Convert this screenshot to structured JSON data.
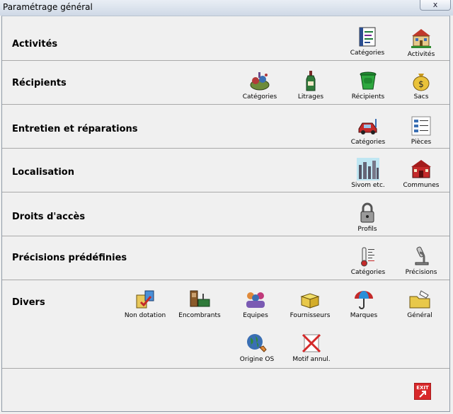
{
  "window": {
    "title": "Paramétrage général",
    "close_glyph": "x"
  },
  "sections": {
    "activites": {
      "title": "Activités",
      "items": [
        {
          "label": "Catégories",
          "icon": "list-icon"
        },
        {
          "label": "Activités",
          "icon": "building-icon"
        }
      ]
    },
    "recipients": {
      "title": "Récipients",
      "items": [
        {
          "label": "Catégories",
          "icon": "waste-pile-icon"
        },
        {
          "label": "Litrages",
          "icon": "bottle-icon"
        },
        {
          "label": "Récipients",
          "icon": "green-bin-icon"
        },
        {
          "label": "Sacs",
          "icon": "money-bag-icon"
        }
      ]
    },
    "entretien": {
      "title": "Entretien et réparations",
      "items": [
        {
          "label": "Catégories",
          "icon": "red-car-icon"
        },
        {
          "label": "Pièces",
          "icon": "parts-list-icon"
        }
      ]
    },
    "localisation": {
      "title": "Localisation",
      "items": [
        {
          "label": "Sivom etc.",
          "icon": "city-skyline-icon"
        },
        {
          "label": "Communes",
          "icon": "red-house-icon"
        }
      ]
    },
    "droits": {
      "title": "Droits d'accès",
      "items": [
        {
          "label": "Profils",
          "icon": "padlock-icon"
        }
      ]
    },
    "precisions": {
      "title": "Précisions prédéfinies",
      "items": [
        {
          "label": "Catégories",
          "icon": "thermometer-icon"
        },
        {
          "label": "Précisions",
          "icon": "microscope-icon"
        }
      ]
    },
    "divers": {
      "title": "Divers",
      "items": [
        {
          "label": "Non dotation",
          "icon": "blocks-icon"
        },
        {
          "label": "Encombrants",
          "icon": "bulky-items-icon"
        },
        {
          "label": "Equipes",
          "icon": "team-icon"
        },
        {
          "label": "Fournisseurs",
          "icon": "open-box-icon"
        },
        {
          "label": "Marques",
          "icon": "umbrella-icon"
        },
        {
          "label": "Général",
          "icon": "folder-hand-icon"
        },
        {
          "label": "Origine OS",
          "icon": "globe-phone-icon"
        },
        {
          "label": "Motif annul.",
          "icon": "red-cross-icon"
        }
      ]
    }
  },
  "footer": {
    "exit_label": "EXIT"
  }
}
